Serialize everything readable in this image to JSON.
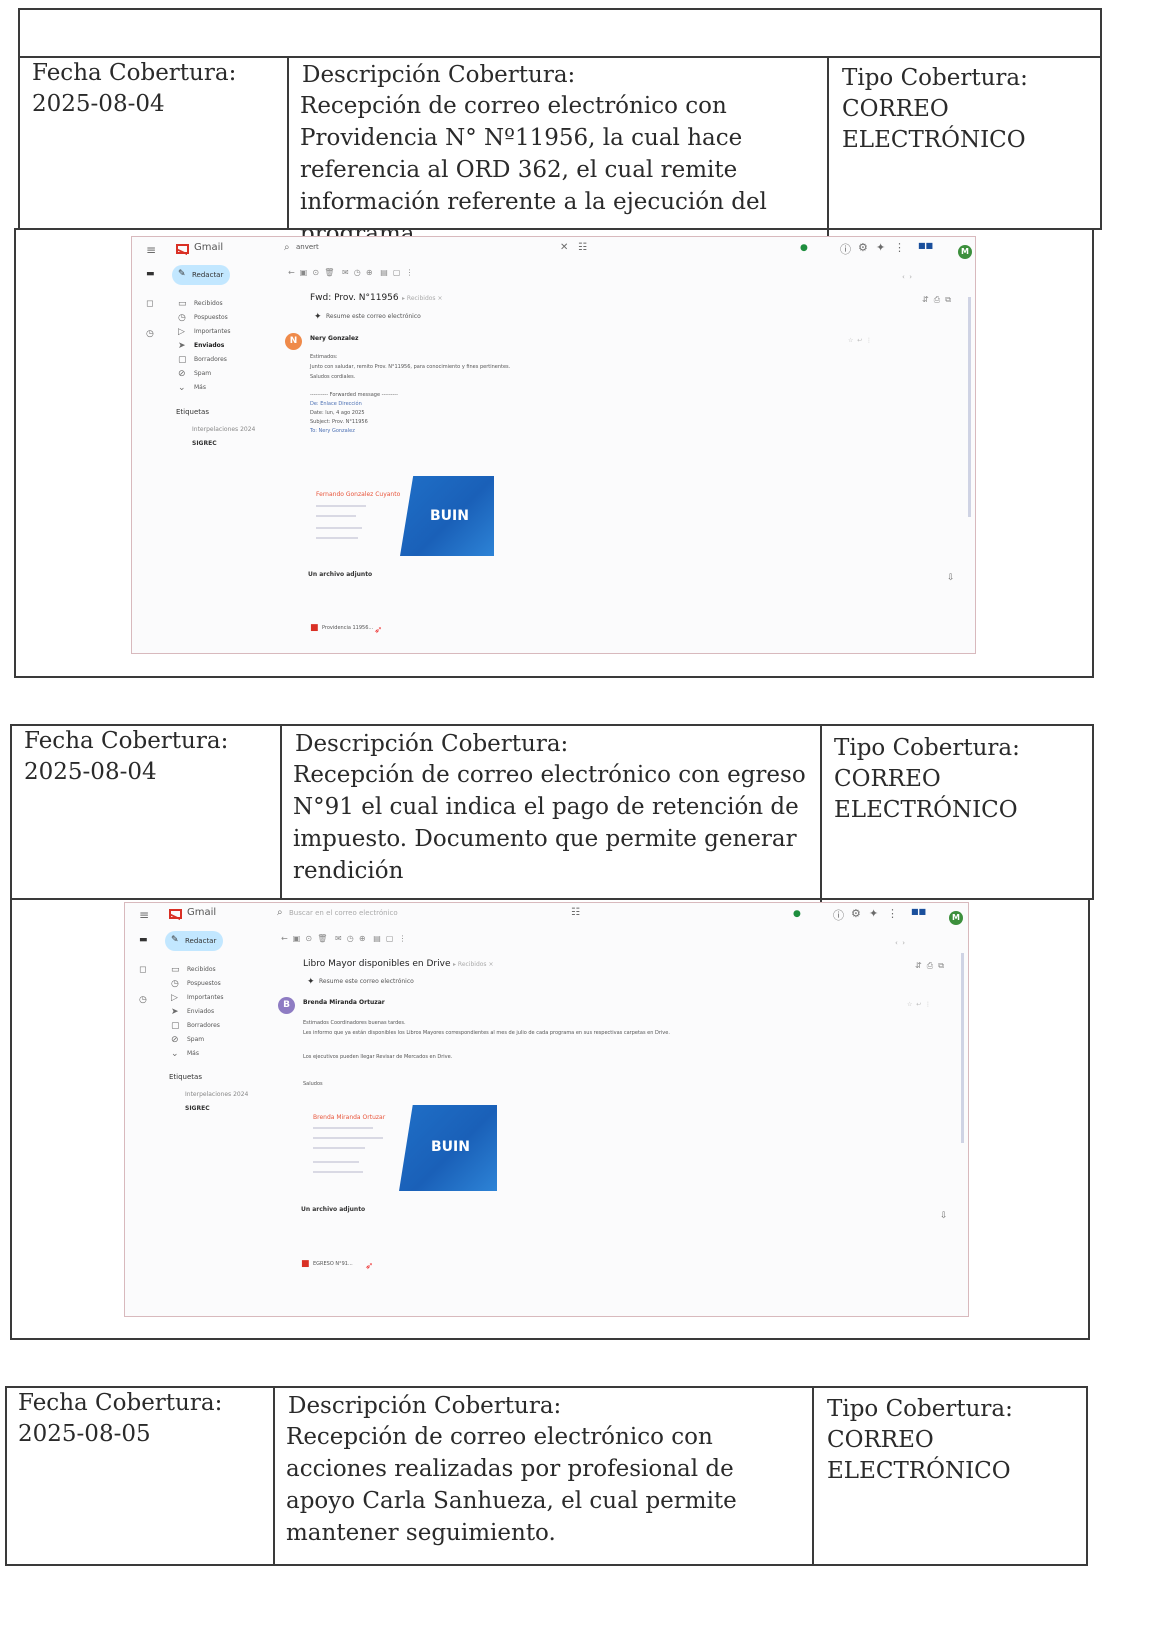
{
  "labels": {
    "fecha": "Fecha Cobertura:",
    "descripcion": "Descripción Cobertura:",
    "tipo": "Tipo Cobertura:"
  },
  "entries": [
    {
      "fecha": "2025-08-04",
      "descripcion": "Recepción de correo electrónico con Providencia N° Nº11956, la cual hace referencia al ORD 362, el cual remite información referente a la ejecución del programa.",
      "tipo_l1": "CORREO",
      "tipo_l2": "ELECTRÓNICO"
    },
    {
      "fecha": "2025-08-04",
      "descripcion": "Recepción de correo electrónico con egreso N°91 el cual indica el pago de retención de impuesto. Documento que permite generar rendición",
      "tipo_l1": "CORREO",
      "tipo_l2": "ELECTRÓNICO"
    },
    {
      "fecha": "2025-08-05",
      "descripcion": "Recepción de correo electrónico con acciones realizadas por profesional de apoyo Carla Sanhueza, el cual permite mantener seguimiento.",
      "tipo_l1": "CORREO",
      "tipo_l2": "ELECTRÓNICO"
    }
  ],
  "screenshots": [
    {
      "app": "Gmail",
      "search": "anvert",
      "compose": "Redactar",
      "folders": [
        "Recibidos",
        "Pospuestos",
        "Importantes",
        "Enviados",
        "Borradores",
        "Spam",
        "Más"
      ],
      "labels_title": "Etiquetas",
      "labels": [
        "Interpelaciones 2024",
        "SIGREC"
      ],
      "subject": "Fwd: Prov. N°11956",
      "summary": "Resume este correo electrónico",
      "sender": "Nery Gonzalez",
      "sender_initial": "N",
      "body": [
        "Estimados:",
        "Junto con saludar, remito Prov. N°11956, para conocimiento y fines pertinentes.",
        "Saludos cordiales."
      ],
      "forward": [
        "---------- Forwarded message ---------",
        "De: Enlace Dirección",
        "Date: lun, 4 ago 2025",
        "Subject: Prov. N°11956",
        "To: Nery Gonzalez"
      ],
      "signature_name": "Fernando Gonzalez Cuyanto",
      "logo": "BUIN",
      "attachment_title": "Un archivo adjunto",
      "attachment_name": "Providencia 11956..."
    },
    {
      "app": "Gmail",
      "search": "Buscar en el correo electrónico",
      "compose": "Redactar",
      "folders": [
        "Recibidos",
        "Pospuestos",
        "Importantes",
        "Enviados",
        "Borradores",
        "Spam",
        "Más"
      ],
      "labels_title": "Etiquetas",
      "labels": [
        "Interpelaciones 2024",
        "SIGREC"
      ],
      "subject": "Libro Mayor disponibles en Drive",
      "summary": "Resume este correo electrónico",
      "sender": "Brenda Miranda Ortuzar",
      "sender_initial": "B",
      "body": [
        "Estimados Coordinadores buenas tardes.",
        "Les informo que ya están disponibles los Libros Mayores correspondientes al mes de julio de cada programa en sus respectivas carpetas en Drive.",
        "Los ejecutivos pueden llegar Revisar de Mercados en Drive.",
        "Saludos"
      ],
      "forward": [],
      "signature_name": "Brenda Miranda Ortuzar",
      "logo": "BUIN",
      "attachment_title": "Un archivo adjunto",
      "attachment_name": "EGRESO N°91..."
    }
  ]
}
